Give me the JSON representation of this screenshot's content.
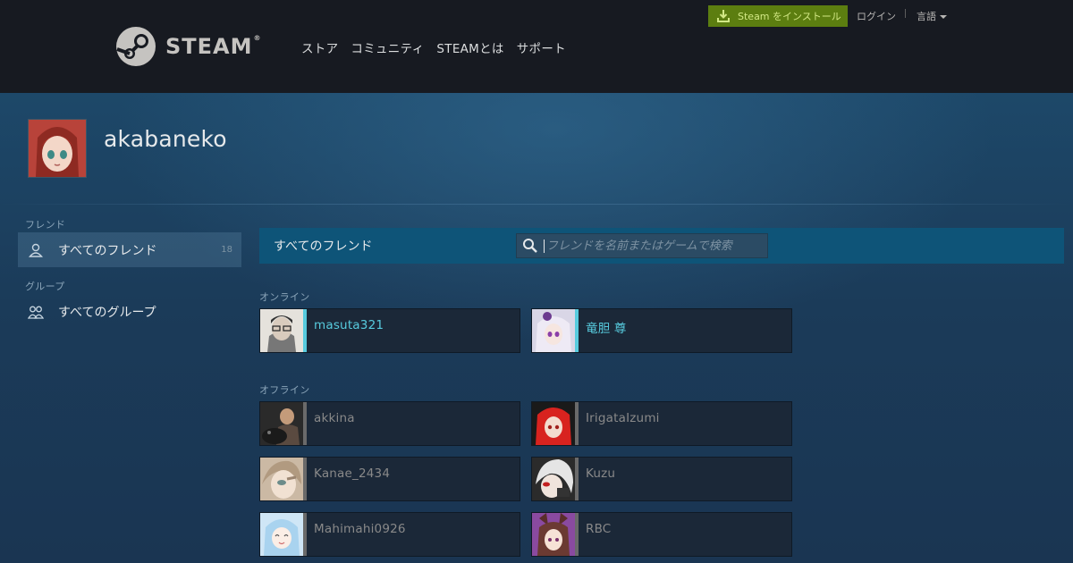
{
  "header": {
    "logo_word": "STEAM",
    "logo_reg": "®",
    "nav": [
      "ストア",
      "コミュニティ",
      "STEAMとは",
      "サポート"
    ],
    "install_label": "Steam をインストール",
    "login_label": "ログイン",
    "language_label": "言語"
  },
  "profile": {
    "name": "akabaneko"
  },
  "sidebar": {
    "friends_heading": "フレンド",
    "all_friends_label": "すべてのフレンド",
    "all_friends_count": "18",
    "groups_heading": "グループ",
    "all_groups_label": "すべてのグループ"
  },
  "friends_panel": {
    "title": "すべてのフレンド",
    "search_placeholder": "フレンドを名前またはゲームで検索",
    "online_heading": "オンライン",
    "offline_heading": "オフライン",
    "online": [
      {
        "name": "masuta321",
        "avatar": "glasses-man"
      },
      {
        "name": "竜胆 尊",
        "avatar": "white-haired-girl"
      }
    ],
    "offline": [
      {
        "name": "akkina",
        "avatar": "cat-man"
      },
      {
        "name": "IrigataIzumi",
        "avatar": "red-haired-girl"
      },
      {
        "name": "Kanae_2434",
        "avatar": "light-haired-boy"
      },
      {
        "name": "Kuzu",
        "avatar": "silver-haired-boy"
      },
      {
        "name": "Mahimahi0926",
        "avatar": "blue-haired-girl"
      },
      {
        "name": "RBC",
        "avatar": "cat-ear-girl"
      }
    ]
  },
  "colors": {
    "online": "#57cbde",
    "offline": "#898989",
    "install_bg": "#5c7e10",
    "header_bg": "#171a21"
  }
}
